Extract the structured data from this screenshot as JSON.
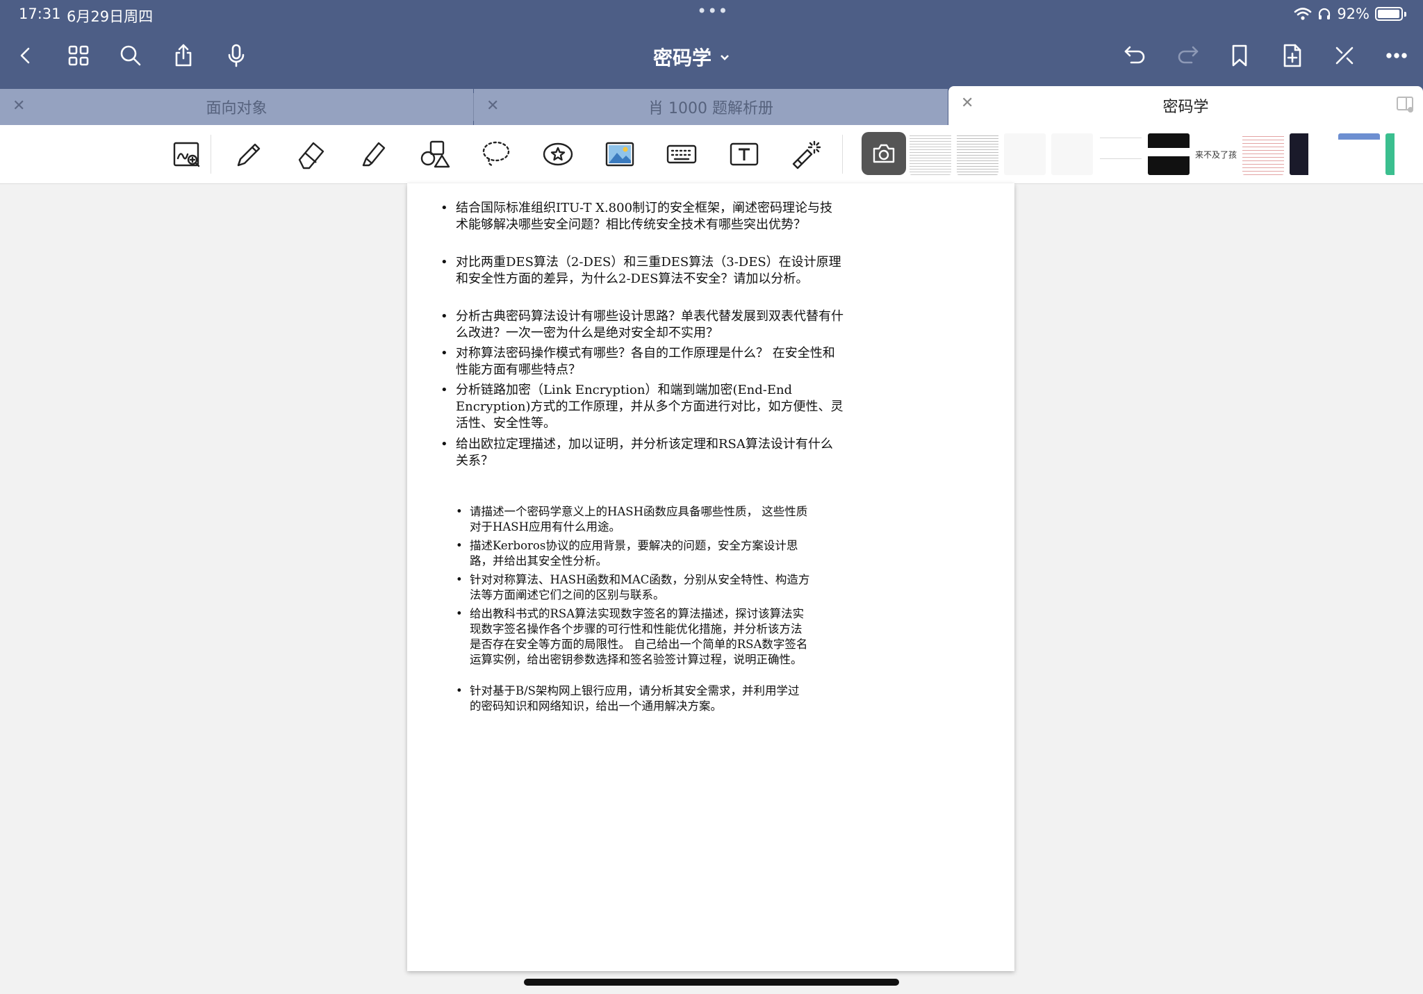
{
  "status": {
    "time": "17:31",
    "date": "6月29日周四",
    "battery": "92%",
    "battery_level": 0.92
  },
  "header": {
    "title": "密码学"
  },
  "tabs": [
    {
      "label": "面向对象",
      "active": false
    },
    {
      "label": "肖 1000 题解析册",
      "active": false
    },
    {
      "label": "密码学",
      "active": true
    }
  ],
  "nav_icons": {
    "left": [
      "back-icon",
      "grid-icon",
      "search-icon",
      "share-icon",
      "microphone-icon"
    ],
    "right": [
      "undo-icon",
      "redo-icon",
      "bookmark-icon",
      "add-page-icon",
      "close-toolbar-icon",
      "more-icon"
    ]
  },
  "toolbar_icons": [
    "zoom-write-icon",
    "pen-icon",
    "eraser-icon",
    "highlighter-icon",
    "shapes-icon",
    "lasso-icon",
    "sticker-icon",
    "image-icon",
    "keyboard-icon",
    "text-box-icon",
    "laser-pointer-icon",
    "camera-icon"
  ],
  "document": {
    "section1": [
      "结合国际标准组织ITU-T X.800制订的安全框架，阐述密码理论与技术能够解决哪些安全问题？相比传统安全技术有哪些突出优势？",
      "对比两重DES算法（2-DES）和三重DES算法（3-DES）在设计原理和安全性方面的差异，为什么2-DES算法不安全？请加以分析。",
      "分析古典密码算法设计有哪些设计思路？单表代替发展到双表代替有什么改进？一次一密为什么是绝对安全却不实用？",
      "对称算法密码操作模式有哪些？各自的工作原理是什么？ 在安全性和性能方面有哪些特点？",
      "分析链路加密（Link Encryption）和端到端加密(End-End Encryption)方式的工作原理，并从多个方面进行对比，如方便性、灵活性、安全性等。",
      "给出欧拉定理描述，加以证明，并分析该定理和RSA算法设计有什么关系？"
    ],
    "section2": [
      "请描述一个密码学意义上的HASH函数应具备哪些性质， 这些性质对于HASH应用有什么用途。",
      "描述Kerboros协议的应用背景，要解决的问题，安全方案设计思路，并给出其安全性分析。",
      "针对对称算法、HASH函数和MAC函数，分别从安全特性、构造方法等方面阐述它们之间的区别与联系。",
      "给出教科书式的RSA算法实现数字签名的算法描述，探讨该算法实现数字签名操作各个步骤的可行性和性能优化措施，并分析该方法是否存在安全等方面的局限性。 自己给出一个简单的RSA数字签名运算实例，给出密钥参数选择和签名验签计算过程，说明正确性。",
      "针对基于B/S架构网上银行应用，请分析其安全需求，并利用学过的密码知识和网络知识，给出一个通用解决方案。"
    ]
  },
  "thumbnails": {
    "thumb_text": "来不及了孩"
  }
}
